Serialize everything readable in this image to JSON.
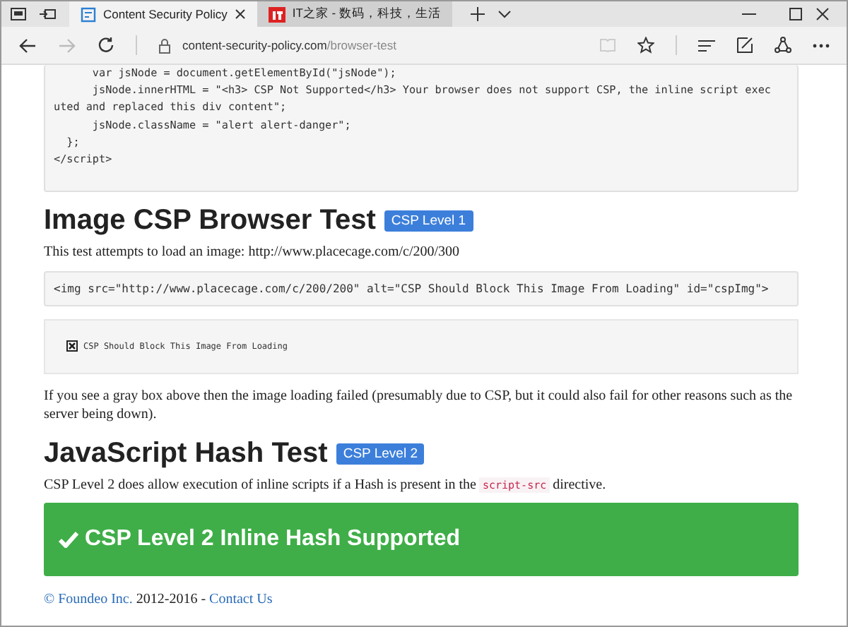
{
  "tabs": [
    {
      "label": "Content Security Policy",
      "selected": true
    },
    {
      "label": "IT之家 - 数码，科技，生活",
      "selected": false
    }
  ],
  "address_bar": {
    "domain": "content-security-policy.com",
    "path": "/browser-test"
  },
  "code_block": {
    "lines": [
      "      var jsNode = document.getElementById(\"jsNode\");",
      "      jsNode.innerHTML = \"<h3> CSP Not Supported</h3> Your browser does not support CSP, the inline script exec",
      "uted and replaced this div content\";",
      "      jsNode.className = \"alert alert-danger\";",
      "  };",
      "</script>"
    ]
  },
  "sections": [
    {
      "heading": "Image CSP Browser Test",
      "badge": "CSP Level 1",
      "blocks": [
        {
          "kind": "text",
          "text": "This test attempts to load an image: http://www.placecage.com/c/200/300"
        },
        {
          "kind": "code",
          "text": "<img src=\"http://www.placecage.com/c/200/200\" alt=\"CSP Should Block This Image From Loading\" id=\"cspImg\">"
        },
        {
          "kind": "broken_image",
          "text": "CSP Should Block This Image From Loading"
        },
        {
          "kind": "text",
          "text": "If you see a gray box above then the image loading failed (presumably due to CSP, but it could also fail for other reasons such as the server being down)."
        }
      ]
    },
    {
      "heading": "JavaScript Hash Test",
      "badge": "CSP Level 2",
      "blocks": [
        {
          "kind": "text_code",
          "before": "CSP Level 2 does allow execution of inline scripts if a Hash is present in the",
          "code": "script-src",
          "after": "directive."
        },
        {
          "kind": "success",
          "text": "CSP Level 2 Inline Hash Supported"
        }
      ]
    }
  ],
  "footer": {
    "company": "© Foundeo Inc.",
    "years": "2012-2016 -",
    "contact": "Contact Us"
  }
}
